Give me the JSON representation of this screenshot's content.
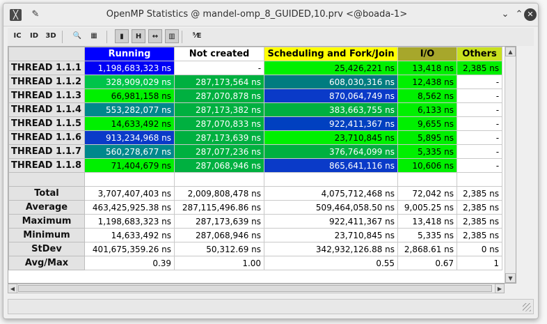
{
  "window": {
    "title": "OpenMP Statistics @ mandel-omp_8_GUIDED,10.prv <@boada-1>"
  },
  "toolbar": [
    {
      "name": "opencontrol-icon",
      "label": "IC",
      "active": false
    },
    {
      "name": "opendata-icon",
      "label": "ID",
      "active": false
    },
    {
      "name": "3d-icon",
      "label": "3D",
      "active": false
    },
    {
      "name": "zoom-icon",
      "label": "🔍",
      "active": false
    },
    {
      "name": "paint-icon",
      "label": "▦",
      "active": false
    },
    {
      "name": "color-mode-icon",
      "label": "▮",
      "active": true
    },
    {
      "name": "hide-columns-icon",
      "label": "H",
      "active": true
    },
    {
      "name": "horizontal-icon",
      "label": "↔",
      "active": true
    },
    {
      "name": "semantic-color-icon",
      "label": "▥",
      "active": true
    },
    {
      "name": "exponent-icon",
      "label": "⁵⁄E",
      "active": false
    }
  ],
  "columns": [
    {
      "label": "Running",
      "bg": "#0000FF",
      "fg": "#FFFFFF"
    },
    {
      "label": "Not created",
      "bg": "#FFFFFF",
      "fg": "#000000"
    },
    {
      "label": "Scheduling and Fork/Join",
      "bg": "#FFFF00",
      "fg": "#000000"
    },
    {
      "label": "I/O",
      "bg": "#A7A72B",
      "fg": "#000000"
    },
    {
      "label": "Others",
      "bg": "#C8E01E",
      "fg": "#000000"
    }
  ],
  "rows": [
    {
      "label": "THREAD 1.1.1",
      "cells": [
        {
          "v": "1,198,683,323 ns",
          "bg": "#0000F5",
          "fg": "#FFFFFF"
        },
        {
          "v": "-",
          "bg": "#FFFFFF",
          "fg": "#000000"
        },
        {
          "v": "25,426,221 ns",
          "bg": "#00F000",
          "fg": "#000000"
        },
        {
          "v": "13,418 ns",
          "bg": "#00F000",
          "fg": "#000000"
        },
        {
          "v": "2,385 ns",
          "bg": "#00F000",
          "fg": "#000000"
        }
      ]
    },
    {
      "label": "THREAD 1.1.2",
      "cells": [
        {
          "v": "328,909,029 ns",
          "bg": "#00C44A",
          "fg": "#FFFFFF"
        },
        {
          "v": "287,173,564 ns",
          "bg": "#00B040",
          "fg": "#FFFFFF"
        },
        {
          "v": "608,030,316 ns",
          "bg": "#007C80",
          "fg": "#FFFFFF"
        },
        {
          "v": "12,438 ns",
          "bg": "#00F000",
          "fg": "#000000"
        },
        {
          "v": "-",
          "bg": "#FFFFFF",
          "fg": "#000000"
        }
      ]
    },
    {
      "label": "THREAD 1.1.3",
      "cells": [
        {
          "v": "66,981,158 ns",
          "bg": "#00F000",
          "fg": "#000000"
        },
        {
          "v": "287,070,878 ns",
          "bg": "#00B040",
          "fg": "#FFFFFF"
        },
        {
          "v": "870,064,749 ns",
          "bg": "#0A3AC8",
          "fg": "#FFFFFF"
        },
        {
          "v": "8,562 ns",
          "bg": "#00F000",
          "fg": "#000000"
        },
        {
          "v": "-",
          "bg": "#FFFFFF",
          "fg": "#000000"
        }
      ]
    },
    {
      "label": "THREAD 1.1.4",
      "cells": [
        {
          "v": "553,282,077 ns",
          "bg": "#00888C",
          "fg": "#FFFFFF"
        },
        {
          "v": "287,173,382 ns",
          "bg": "#00B040",
          "fg": "#FFFFFF"
        },
        {
          "v": "383,663,755 ns",
          "bg": "#00B040",
          "fg": "#FFFFFF"
        },
        {
          "v": "6,133 ns",
          "bg": "#00F000",
          "fg": "#000000"
        },
        {
          "v": "-",
          "bg": "#FFFFFF",
          "fg": "#000000"
        }
      ]
    },
    {
      "label": "THREAD 1.1.5",
      "cells": [
        {
          "v": "14,633,492 ns",
          "bg": "#00F000",
          "fg": "#000000"
        },
        {
          "v": "287,070,833 ns",
          "bg": "#00B040",
          "fg": "#FFFFFF"
        },
        {
          "v": "922,411,367 ns",
          "bg": "#0040C0",
          "fg": "#FFFFFF"
        },
        {
          "v": "9,655 ns",
          "bg": "#00F000",
          "fg": "#000000"
        },
        {
          "v": "-",
          "bg": "#FFFFFF",
          "fg": "#000000"
        }
      ]
    },
    {
      "label": "THREAD 1.1.6",
      "cells": [
        {
          "v": "913,234,968 ns",
          "bg": "#0A3AC8",
          "fg": "#FFFFFF"
        },
        {
          "v": "287,173,639 ns",
          "bg": "#00B040",
          "fg": "#FFFFFF"
        },
        {
          "v": "23,710,845 ns",
          "bg": "#00F000",
          "fg": "#000000"
        },
        {
          "v": "5,895 ns",
          "bg": "#00F000",
          "fg": "#000000"
        },
        {
          "v": "-",
          "bg": "#FFFFFF",
          "fg": "#000000"
        }
      ]
    },
    {
      "label": "THREAD 1.1.7",
      "cells": [
        {
          "v": "560,278,677 ns",
          "bg": "#00888C",
          "fg": "#FFFFFF"
        },
        {
          "v": "287,077,236 ns",
          "bg": "#00B040",
          "fg": "#FFFFFF"
        },
        {
          "v": "376,764,099 ns",
          "bg": "#00B040",
          "fg": "#FFFFFF"
        },
        {
          "v": "5,335 ns",
          "bg": "#00F000",
          "fg": "#000000"
        },
        {
          "v": "-",
          "bg": "#FFFFFF",
          "fg": "#000000"
        }
      ]
    },
    {
      "label": "THREAD 1.1.8",
      "cells": [
        {
          "v": "71,404,679 ns",
          "bg": "#00F000",
          "fg": "#000000"
        },
        {
          "v": "287,068,946 ns",
          "bg": "#00B040",
          "fg": "#FFFFFF"
        },
        {
          "v": "865,641,116 ns",
          "bg": "#0A3AC8",
          "fg": "#FFFFFF"
        },
        {
          "v": "10,606 ns",
          "bg": "#00F000",
          "fg": "#000000"
        },
        {
          "v": "-",
          "bg": "#FFFFFF",
          "fg": "#000000"
        }
      ]
    }
  ],
  "stats": [
    {
      "label": "Total",
      "values": [
        "3,707,407,403 ns",
        "2,009,808,478 ns",
        "4,075,712,468 ns",
        "72,042 ns",
        "2,385 ns"
      ]
    },
    {
      "label": "Average",
      "values": [
        "463,425,925.38 ns",
        "287,115,496.86 ns",
        "509,464,058.50 ns",
        "9,005.25 ns",
        "2,385 ns"
      ]
    },
    {
      "label": "Maximum",
      "values": [
        "1,198,683,323 ns",
        "287,173,639 ns",
        "922,411,367 ns",
        "13,418 ns",
        "2,385 ns"
      ]
    },
    {
      "label": "Minimum",
      "values": [
        "14,633,492 ns",
        "287,068,946 ns",
        "23,710,845 ns",
        "5,335 ns",
        "2,385 ns"
      ]
    },
    {
      "label": "StDev",
      "values": [
        "401,675,359.26 ns",
        "50,312.69 ns",
        "342,932,126.88 ns",
        "2,868.61 ns",
        "0 ns"
      ]
    },
    {
      "label": "Avg/Max",
      "values": [
        "0.39",
        "1.00",
        "0.55",
        "0.67",
        "1"
      ]
    }
  ],
  "colors": {
    "header_bg": "#E3E3E3",
    "grid_line": "#C9C9C9"
  }
}
